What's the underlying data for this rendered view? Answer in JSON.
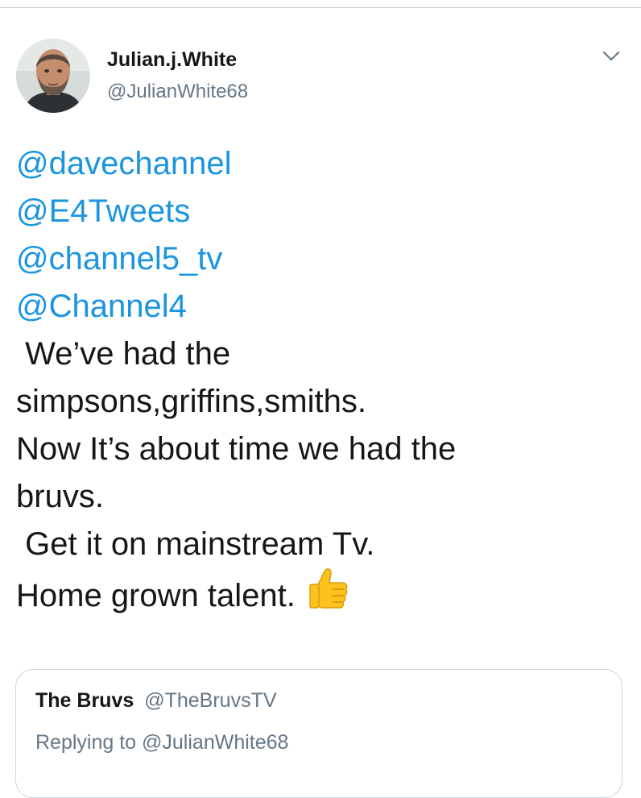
{
  "tweet": {
    "author": {
      "display_name": "Julian.j.White",
      "handle": "@JulianWhite68",
      "avatar_icon": "profile-photo"
    },
    "menu_icon": "chevron-down-icon",
    "lines": [
      {
        "text": "@davechannel",
        "kind": "mention"
      },
      {
        "text": "@E4Tweets",
        "kind": "mention"
      },
      {
        "text": "@channel5_tv",
        "kind": "mention"
      },
      {
        "text": "@Channel4",
        "kind": "mention"
      },
      {
        "text": " We’ve had the",
        "kind": "text"
      },
      {
        "text": "simpsons,griffins,smiths.",
        "kind": "text"
      },
      {
        "text": "Now It’s about time we had the",
        "kind": "text"
      },
      {
        "text": "bruvs.",
        "kind": "text"
      },
      {
        "text": " Get it on mainstream Tv.",
        "kind": "text"
      },
      {
        "text": "Home grown talent.",
        "kind": "text",
        "emoji": "thumbs-up-icon"
      }
    ]
  },
  "quoted_tweet": {
    "name": "The Bruvs",
    "handle": "@TheBruvsTV",
    "replying_to": "Replying to @JulianWhite68"
  },
  "colors": {
    "link": "#1b95e0",
    "text": "#14171a",
    "secondary": "#657786",
    "border": "#ccd6dd"
  }
}
